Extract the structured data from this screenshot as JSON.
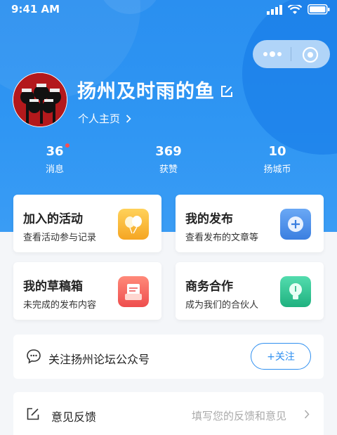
{
  "status_bar": {
    "time": "9:41 AM"
  },
  "profile": {
    "name": "扬州及时雨的鱼",
    "homepage_label": "个人主页"
  },
  "stats": [
    {
      "value": "36",
      "label": "消息",
      "has_dot": true
    },
    {
      "value": "369",
      "label": "获赞"
    },
    {
      "value": "10",
      "label": "扬城币"
    }
  ],
  "cards": [
    {
      "title": "加入的活动",
      "subtitle": "查看活动参与记录",
      "icon": "balloon-icon",
      "color": "#f7b731"
    },
    {
      "title": "我的发布",
      "subtitle": "查看发布的文章等",
      "icon": "add-circle-icon",
      "color": "#4a8fe8"
    },
    {
      "title": "我的草稿箱",
      "subtitle": "未完成的发布内容",
      "icon": "drafts-icon",
      "color": "#f25c5c"
    },
    {
      "title": "商务合作",
      "subtitle": "成为我们的合伙人",
      "icon": "lightbulb-icon",
      "color": "#27c08c"
    }
  ],
  "follow": {
    "text": "关注扬州论坛公众号",
    "button": "+关注"
  },
  "feedback": {
    "text": "意见反馈",
    "hint": "填写您的反馈和意见"
  },
  "colors": {
    "accent": "#2f8ff0",
    "background": "#f4f6f9"
  }
}
